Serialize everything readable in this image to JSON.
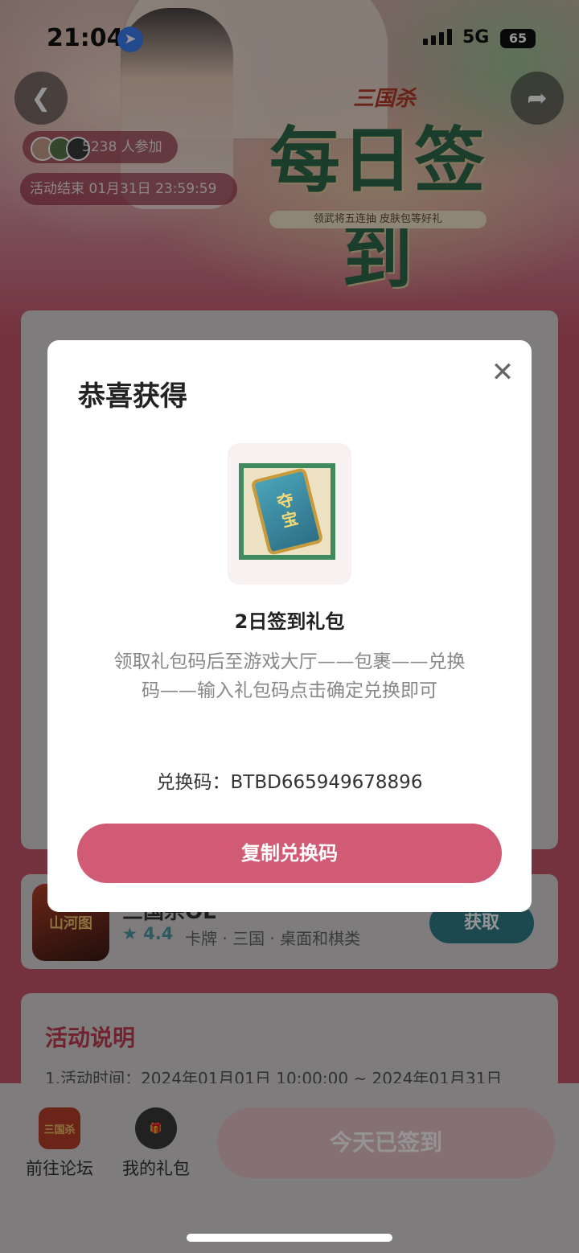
{
  "status_bar": {
    "time": "21:04",
    "network": "5G",
    "battery": "65"
  },
  "hero": {
    "logo": "三国杀",
    "title": "每日签到",
    "subtitle": "领武将五连抽 皮肤包等好礼",
    "participants": "5238 人参加",
    "end_time": "活动结束 01月31日 23:59:59"
  },
  "game": {
    "icon_label": "山河图",
    "name": "三国杀OL",
    "rating": "4.4",
    "tags": "卡牌 · 三国 · 桌面和棋类",
    "get_label": "获取"
  },
  "activity": {
    "title": "活动说明",
    "line1": "1.活动时间：2024年01月01日 10:00:00 ~ 2024年01月31日"
  },
  "bottom_bar": {
    "forum_label": "前往论坛",
    "gifts_label": "我的礼包",
    "signed_label": "今天已签到"
  },
  "modal": {
    "title": "恭喜获得",
    "prize_art_text": "夺宝",
    "gift_name": "2日签到礼包",
    "description": "领取礼包码后至游戏大厅——包裹——兑换码——输入礼包码点击确定兑换即可",
    "code_label": "兑换码：",
    "code_value": "BTBD665949678896",
    "copy_button": "复制兑换码"
  }
}
